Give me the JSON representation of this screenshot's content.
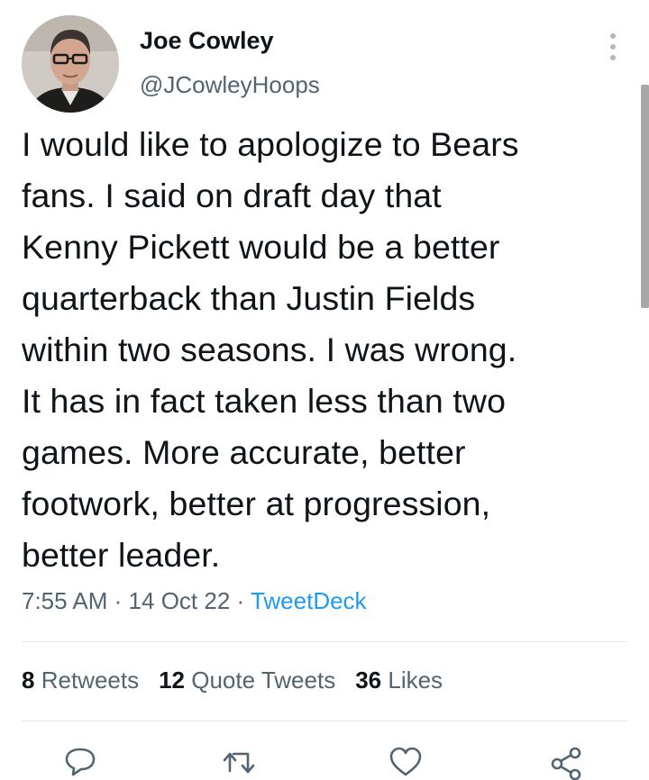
{
  "author": {
    "display_name": "Joe Cowley",
    "handle": "@JCowleyHoops"
  },
  "tweet": {
    "text": "I would like to apologize to Bears\nfans. I said on draft day that\nKenny Pickett would be a better\nquarterback than Justin Fields\nwithin two seasons. I was wrong.\nIt has in fact taken less than two\ngames. More accurate, better\nfootwork, better at progression,\nbetter leader.",
    "time": "7:55 AM",
    "separator": "·",
    "date": "14 Oct 22",
    "source": "TweetDeck"
  },
  "stats": {
    "retweets_count": "8",
    "retweets_label": "Retweets",
    "quotes_count": "12",
    "quotes_label": "Quote Tweets",
    "likes_count": "36",
    "likes_label": "Likes"
  },
  "icons": {
    "more": "more-vertical-icon",
    "reply": "reply-icon",
    "retweet": "retweet-icon",
    "like": "heart-icon",
    "share": "share-icon"
  },
  "colors": {
    "text": "#0f1419",
    "secondary": "#536471",
    "link": "#1d9bf0",
    "divider": "#e1e6ea"
  }
}
